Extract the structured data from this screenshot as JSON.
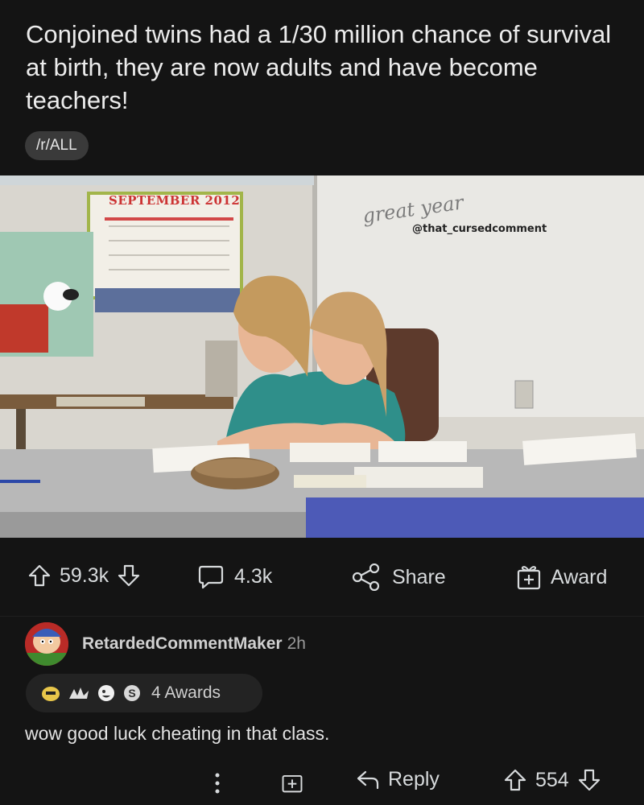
{
  "post": {
    "title": "Conjoined twins had a 1/30 million chance of survival at birth, they are now adults and have become teachers!",
    "subreddit": "/r/ALL",
    "image": {
      "watermark": "@that_cursedcomment",
      "whiteboard_text": "great year",
      "calendar_text": "SEPTEMBER 2012"
    },
    "actions": {
      "score": "59.3k",
      "comments": "4.3k",
      "share_label": "Share",
      "award_label": "Award",
      "icons": [
        "upvote-icon",
        "downvote-icon",
        "comment-icon",
        "share-icon",
        "award-icon"
      ]
    }
  },
  "comment": {
    "username": "RetardedCommentMaker",
    "time": "2h",
    "awards_label": "4 Awards",
    "body": "wow good luck cheating in that class.",
    "reply_label": "Reply",
    "score": "554"
  },
  "colors": {
    "background": "#141414",
    "text": "#d7dadc",
    "pill": "#3a3a3a"
  }
}
